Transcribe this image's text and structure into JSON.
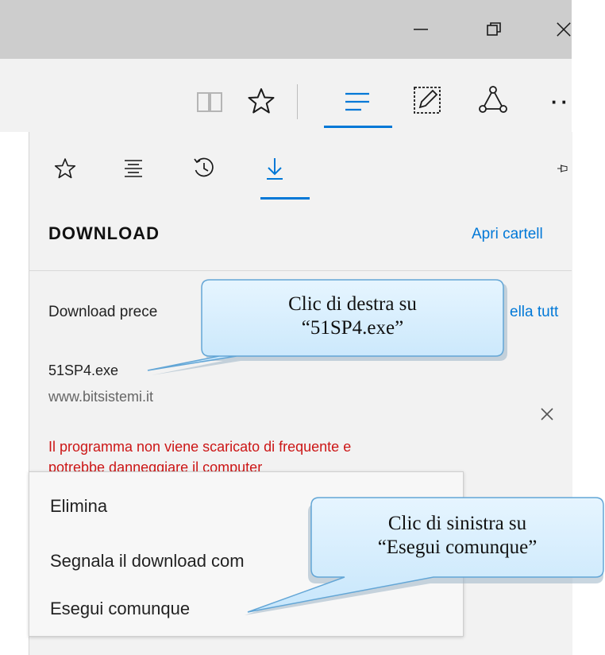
{
  "window_controls": {
    "minimize_glyph": "—",
    "restore_glyph": "❐",
    "close_glyph": "✕"
  },
  "toolbar": {
    "icons": [
      "reading-view-icon",
      "favorite-star-icon",
      "hub-icon",
      "web-note-icon",
      "share-icon",
      "more-icon"
    ],
    "more_glyph": "··"
  },
  "hub_panel": {
    "tabs": [
      "favorites",
      "reading-list",
      "history",
      "downloads"
    ],
    "active_tab": "downloads",
    "title": "DOWNLOAD",
    "open_folder_link": "Apri cartell",
    "section_label": "Download prece",
    "clear_all_link": "ella tutt",
    "item": {
      "file_name": "51SP4.exe",
      "source": "www.bitsistemi.it",
      "warning_line1": "Il programma non viene scaricato di frequente e",
      "warning_line2": "potrebbe danneggiare il computer"
    }
  },
  "context_menu": {
    "items": [
      "Elimina",
      "Segnala il download com",
      "Esegui comunque"
    ]
  },
  "callouts": [
    {
      "line1": "Clic di destra su",
      "line2": "“51SP4.exe”"
    },
    {
      "line1": "Clic di sinistra su",
      "line2": "“Esegui comunque”"
    }
  ],
  "colors": {
    "accent": "#0078d7",
    "warning": "#cc1616",
    "callout_fill": "#d9efff",
    "callout_border": "#63a6d6"
  }
}
